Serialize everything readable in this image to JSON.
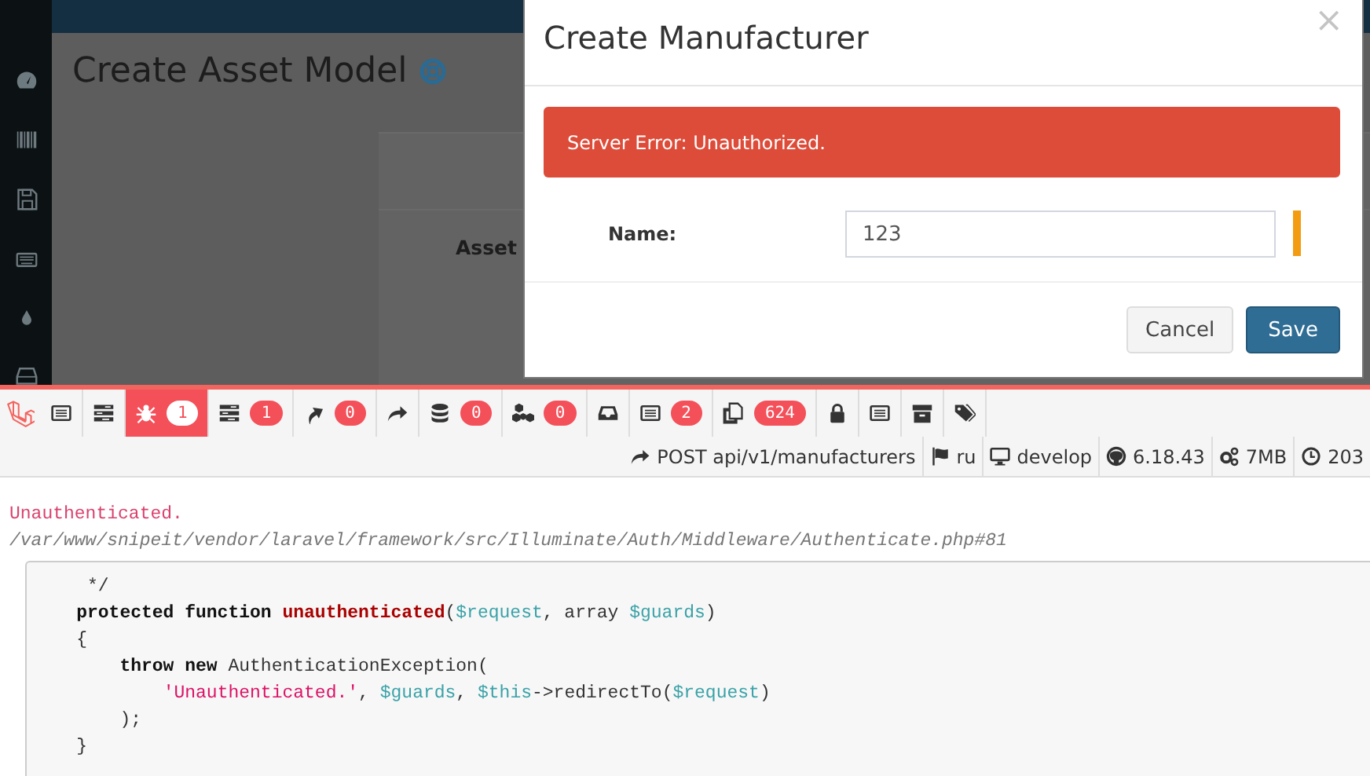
{
  "app": {
    "page_title": "Create Asset Model",
    "form_label": "Asset"
  },
  "modal": {
    "title": "Create Manufacturer",
    "close": "×",
    "alert": "Server Error: Unauthorized.",
    "field": {
      "label": "Name:",
      "value": "123"
    },
    "buttons": [
      {
        "label": "Cancel",
        "kind": "default"
      },
      {
        "label": "Save",
        "kind": "primary"
      }
    ]
  },
  "debugbar": {
    "tabs": [
      {
        "kind": "messages",
        "selected": false
      },
      {
        "kind": "timeline",
        "selected": false
      },
      {
        "kind": "exceptions",
        "badge": "1",
        "selected": true
      },
      {
        "kind": "views",
        "badge": "1",
        "selected": false
      },
      {
        "kind": "route",
        "badge": "0",
        "selected": false
      },
      {
        "kind": "redirect",
        "selected": false
      },
      {
        "kind": "queries",
        "badge": "0",
        "selected": false
      },
      {
        "kind": "models",
        "badge": "0",
        "selected": false
      },
      {
        "kind": "mails",
        "selected": false
      },
      {
        "kind": "logs",
        "badge": "2",
        "selected": false
      },
      {
        "kind": "files",
        "badge": "624",
        "selected": false
      },
      {
        "kind": "auth",
        "selected": false
      },
      {
        "kind": "request",
        "selected": false
      },
      {
        "kind": "session",
        "selected": false
      },
      {
        "kind": "tags",
        "selected": false
      }
    ],
    "info": [
      {
        "kind": "route",
        "text": "POST api/v1/manufacturers"
      },
      {
        "kind": "locale",
        "text": "ru"
      },
      {
        "kind": "env",
        "text": "develop"
      },
      {
        "kind": "version",
        "text": "6.18.43"
      },
      {
        "kind": "memory",
        "text": "7MB"
      },
      {
        "kind": "time",
        "text": "203"
      }
    ],
    "exception": {
      "message": "Unauthenticated.",
      "path": "/var/www/snipeit/vendor/laravel/framework/src/Illuminate/Auth/Middleware/Authenticate.php#81",
      "code": [
        {
          "tokens": [
            {
              "text": " */",
              "kind": "plain"
            }
          ]
        },
        {
          "tokens": [
            {
              "text": "protected function ",
              "kind": "keyword"
            },
            {
              "text": "unauthenticated",
              "kind": "function"
            },
            {
              "text": "(",
              "kind": "plain"
            },
            {
              "text": "$request",
              "kind": "variable"
            },
            {
              "text": ", array ",
              "kind": "plain"
            },
            {
              "text": "$guards",
              "kind": "variable"
            },
            {
              "text": ")",
              "kind": "plain"
            }
          ]
        },
        {
          "tokens": [
            {
              "text": "{",
              "kind": "plain"
            }
          ],
          "children": [
            {
              "tokens": [
                {
                  "text": "throw new ",
                  "kind": "keyword"
                },
                {
                  "text": "AuthenticationException(",
                  "kind": "plain"
                }
              ],
              "children": [
                {
                  "tokens": [
                    {
                      "text": "'Unauthenticated.'",
                      "kind": "string"
                    },
                    {
                      "text": ", ",
                      "kind": "plain"
                    },
                    {
                      "text": "$guards",
                      "kind": "variable"
                    },
                    {
                      "text": ", ",
                      "kind": "plain"
                    },
                    {
                      "text": "$this",
                      "kind": "variable"
                    },
                    {
                      "text": "->redirectTo(",
                      "kind": "plain"
                    },
                    {
                      "text": "$request",
                      "kind": "variable"
                    },
                    {
                      "text": ")",
                      "kind": "plain"
                    }
                  ]
                }
              ]
            },
            {
              "tokens": [
                {
                  "text": ");",
                  "kind": "plain"
                }
              ]
            }
          ]
        },
        {
          "tokens": [
            {
              "text": "}",
              "kind": "plain"
            }
          ]
        }
      ]
    }
  }
}
